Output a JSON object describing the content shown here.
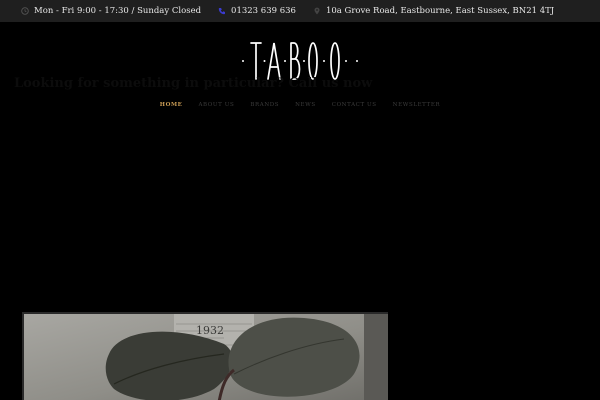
{
  "topbar": {
    "hours": "Mon - Fri 9:00 - 17:30 / Sunday Closed",
    "phone": "01323 639 636",
    "address": "10a Grove Road, Eastbourne, East Sussex, BN21 4TJ"
  },
  "logo": {
    "text": "TABOO"
  },
  "nav": {
    "items": [
      {
        "label": "HOME",
        "active": true
      },
      {
        "label": "ABOUT US",
        "active": false
      },
      {
        "label": "BRANDS",
        "active": false
      },
      {
        "label": "NEWS",
        "active": false
      },
      {
        "label": "CONTACT US",
        "active": false
      },
      {
        "label": "NEWSLETTER",
        "active": false
      }
    ]
  },
  "hero": {
    "heading": "Looking for something in particular? Call us now",
    "watermark": "1932"
  },
  "colors": {
    "background": "#000000",
    "topbar": "#1f1f1f",
    "nav_active": "#c99c55",
    "nav_inactive": "#3c3c3c",
    "phone_icon": "#3b3bd0"
  },
  "icons": {
    "hours": "clock-icon",
    "phone": "phone-icon",
    "address": "map-pin-icon"
  }
}
